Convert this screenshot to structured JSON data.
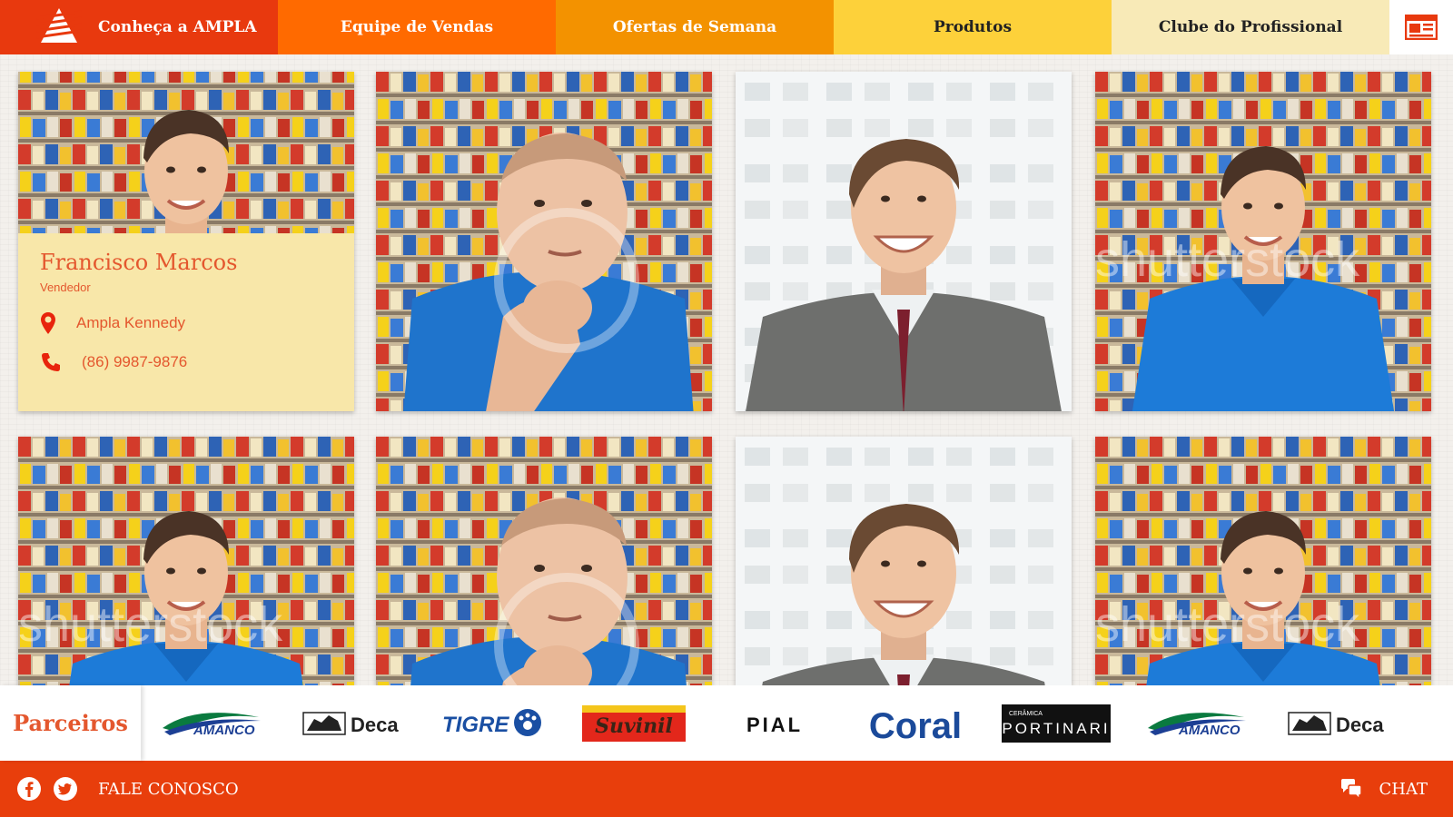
{
  "nav": {
    "tabs": [
      {
        "label_prefix": "Conheça a",
        "label_brand": "AMPLA"
      },
      {
        "label": "Equipe de Vendas"
      },
      {
        "label": "Ofertas de Semana"
      },
      {
        "label": "Produtos"
      },
      {
        "label": "Clube do Profissional"
      }
    ],
    "menu_icon": "newspaper-icon"
  },
  "featured": {
    "name": "Francisco Marcos",
    "role": "Vendedor",
    "store": "Ampla Kennedy",
    "phone": "(86) 9987-9876"
  },
  "watermark": "shutterstock",
  "partners": {
    "title": "Parceiros",
    "logos": [
      "AMANCO",
      "Deca",
      "TIGRE",
      "Suvinil",
      "PIAL",
      "Coral",
      "PORTINARI",
      "AMANCO",
      "Deca"
    ],
    "logo_sublabel": "CERÂMICA"
  },
  "footer": {
    "contact": "FALE CONOSCO",
    "chat": "CHAT",
    "social_icons": [
      "facebook-icon",
      "twitter-icon"
    ]
  },
  "colors": {
    "brand_red": "#e8390e",
    "accent_text": "#e4572e",
    "info_panel": "#f8e7a9"
  }
}
